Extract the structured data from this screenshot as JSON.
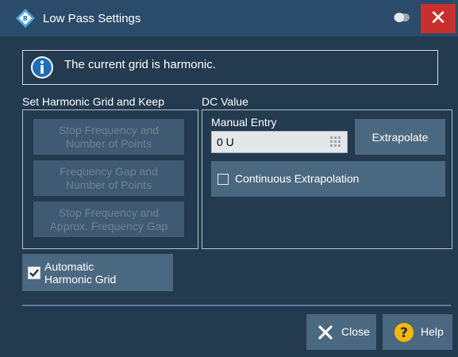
{
  "window": {
    "title": "Low Pass Settings",
    "close_label": "✕"
  },
  "info": {
    "text": "The current grid is harmonic."
  },
  "harmonic_group": {
    "label": "Set Harmonic Grid and Keep",
    "buttons": [
      {
        "line1": "Stop Frequency and",
        "line2": "Number of Points"
      },
      {
        "line1": "Frequency Gap and",
        "line2": "Number of Points"
      },
      {
        "line1": "Stop Frequency and",
        "line2": "Approx. Frequency Gap"
      }
    ]
  },
  "dc_group": {
    "label": "DC Value",
    "manual_entry_label": "Manual Entry",
    "manual_entry_value": "0 U",
    "extrapolate_label": "Extrapolate",
    "continuous_label": "Continuous Extrapolation",
    "continuous_checked": false
  },
  "auto_grid": {
    "line1": "Automatic",
    "line2": "Harmonic Grid",
    "checked": true
  },
  "footer": {
    "close_label": "Close",
    "help_label": "Help"
  },
  "colors": {
    "title_bar": "#2b4b6a",
    "body": "#233a4f",
    "button": "#4a6880",
    "close_red": "#c8302d",
    "help_yellow": "#f5b800"
  }
}
